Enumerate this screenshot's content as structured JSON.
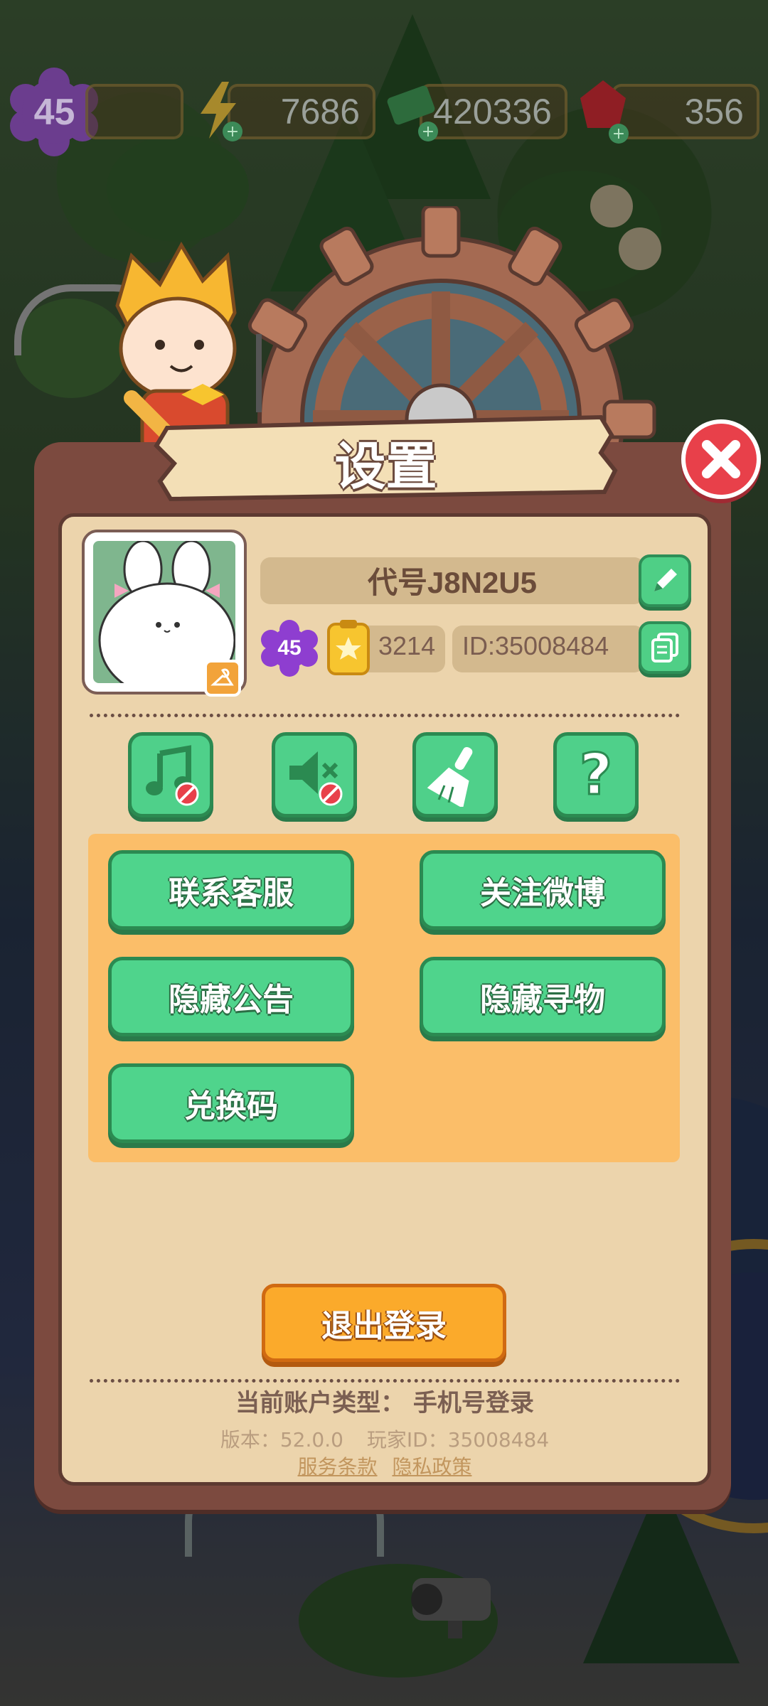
{
  "hud": {
    "level": "45",
    "energy": "7686",
    "cash": "420336",
    "gems": "356"
  },
  "dialog": {
    "title": "设置"
  },
  "profile": {
    "name": "代号J8N2U5",
    "level": "45",
    "stars": "3214",
    "id_label": "ID:35008484"
  },
  "icon_buttons": [
    {
      "name": "music-off-button",
      "icon": "music-note-icon"
    },
    {
      "name": "sound-off-button",
      "icon": "speaker-mute-icon"
    },
    {
      "name": "clear-cache-button",
      "icon": "broom-icon"
    },
    {
      "name": "help-button",
      "icon": "question-icon"
    }
  ],
  "menu": {
    "contact_service": "联系客服",
    "follow_weibo": "关注微博",
    "hide_notice": "隐藏公告",
    "hide_search": "隐藏寻物",
    "redeem_code": "兑换码"
  },
  "logout": "退出登录",
  "footer": {
    "account_type": "当前账户类型：  手机号登录",
    "version": "版本：52.0.0",
    "player_id": "玩家ID：35008484",
    "terms": "服务条款",
    "privacy": "隐私政策"
  },
  "colors": {
    "panel": "#7c4a3f",
    "panel_inner": "#ecd4ac",
    "green_button": "#4fd48c",
    "orange_area": "#fbbe69",
    "logout_button": "#fbaa2b",
    "close_button": "#e8404a"
  }
}
